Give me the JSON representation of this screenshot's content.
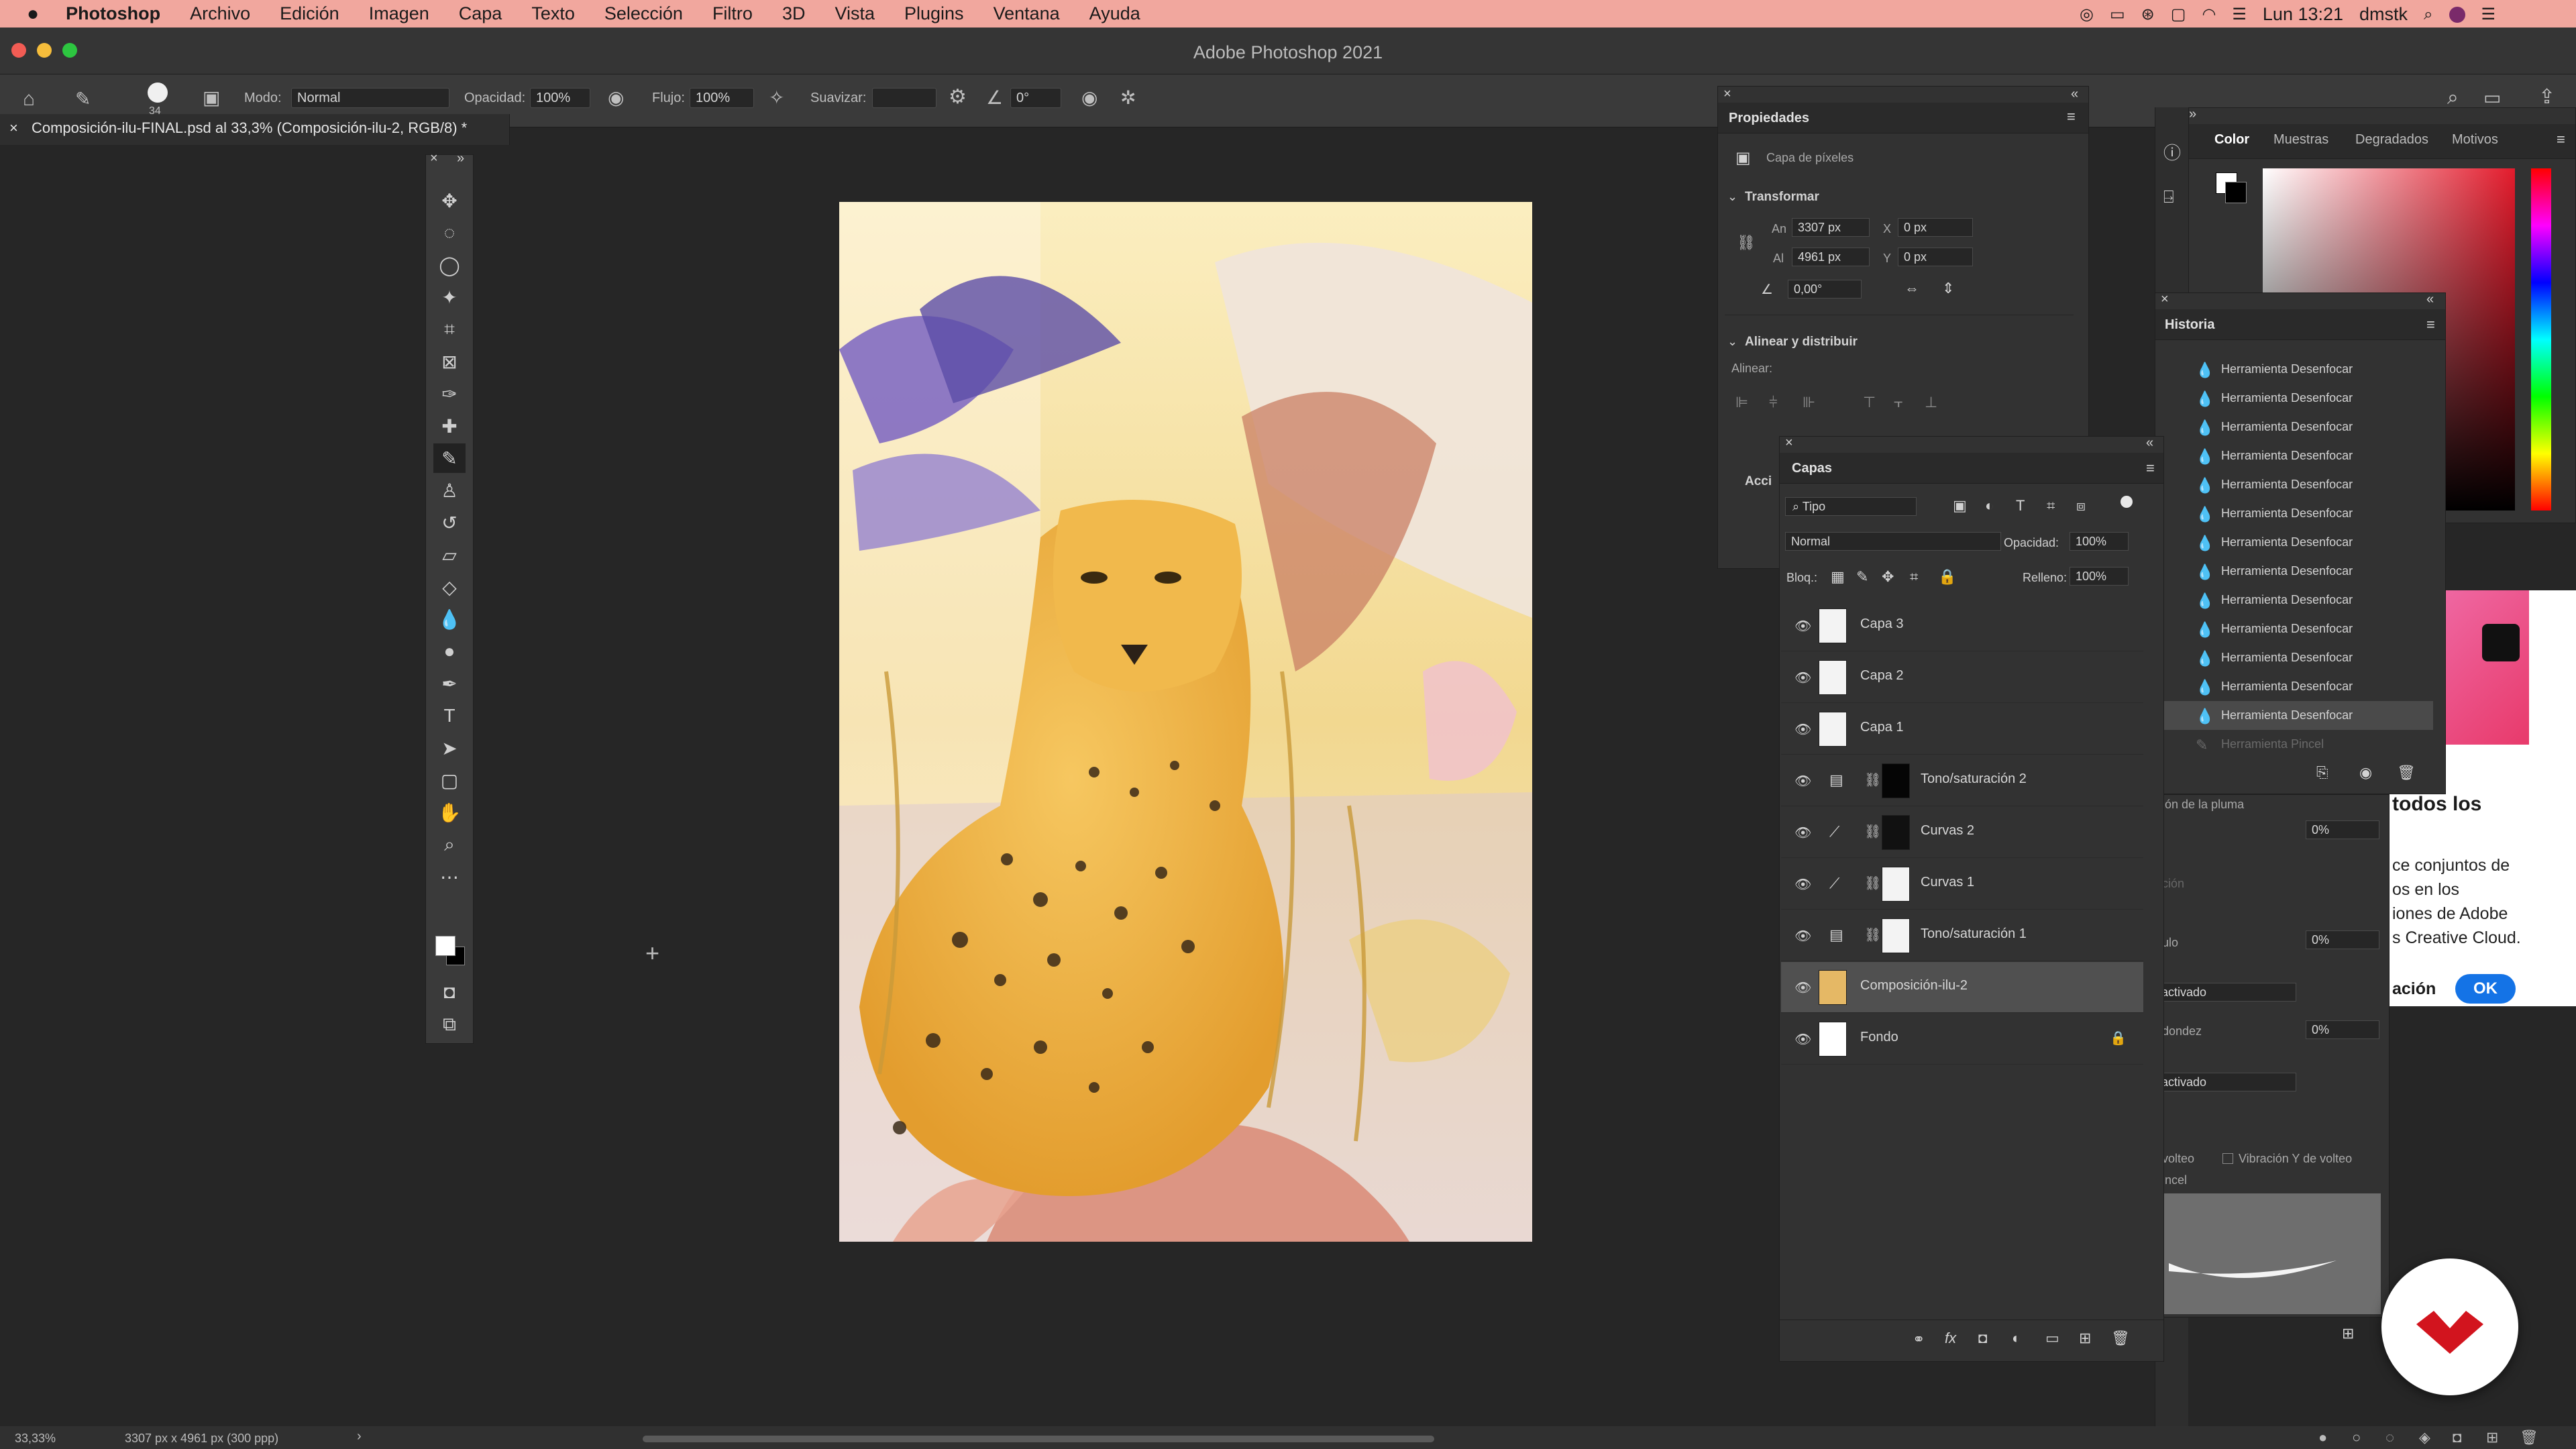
{
  "menubar": {
    "apple": "",
    "app": "Photoshop",
    "items": [
      "Archivo",
      "Edición",
      "Imagen",
      "Capa",
      "Texto",
      "Selección",
      "Filtro",
      "3D",
      "Vista",
      "Plugins",
      "Ventana",
      "Ayuda"
    ],
    "clock": "Lun 13:21",
    "user": "dmstk"
  },
  "window": {
    "title": "Adobe Photoshop 2021"
  },
  "options": {
    "brush_size": "34",
    "mode_label": "Modo:",
    "mode_value": "Normal",
    "opacity_label": "Opacidad:",
    "opacity_value": "100%",
    "flow_label": "Flujo:",
    "flow_value": "100%",
    "smoothing_label": "Suavizar:",
    "angle_value": "0°"
  },
  "document": {
    "tab_title": "Composición-ilu-FINAL.psd al 33,3% (Composición-ilu-2, RGB/8) *"
  },
  "toolbar": {
    "icons": [
      "move-icon",
      "marquee-icon",
      "lasso-icon",
      "magic-wand-icon",
      "crop-icon",
      "frame-icon",
      "eyedropper-icon",
      "healing-icon",
      "brush-icon",
      "stamp-icon",
      "history-brush-icon",
      "eraser-icon",
      "bucket-icon",
      "blur-icon",
      "dodge-icon",
      "pen-icon",
      "type-icon",
      "path-select-icon",
      "shape-icon",
      "hand-icon",
      "zoom-icon",
      "more-icon"
    ]
  },
  "properties": {
    "title": "Propiedades",
    "kind": "Capa de píxeles",
    "transform": "Transformar",
    "w_label": "An",
    "w_value": "3307 px",
    "h_label": "Al",
    "h_value": "4961 px",
    "x_label": "X",
    "x_value": "0 px",
    "y_label": "Y",
    "y_value": "0 px",
    "angle": "0,00°",
    "align_section": "Alinear y distribuir",
    "align_label": "Alinear:",
    "acc": "Acci"
  },
  "color_panel": {
    "tabs": [
      "Color",
      "Muestras",
      "Degradados",
      "Motivos"
    ]
  },
  "history": {
    "title": "Historia",
    "items": [
      "Herramienta Desenfocar",
      "Herramienta Desenfocar",
      "Herramienta Desenfocar",
      "Herramienta Desenfocar",
      "Herramienta Desenfocar",
      "Herramienta Desenfocar",
      "Herramienta Desenfocar",
      "Herramienta Desenfocar",
      "Herramienta Desenfocar",
      "Herramienta Desenfocar",
      "Herramienta Desenfocar",
      "Herramienta Desenfocar",
      "Herramienta Desenfocar",
      "Herramienta Pincel"
    ]
  },
  "layers": {
    "title": "Capas",
    "filter": "Tipo",
    "blend": "Normal",
    "opacity_label": "Opacidad:",
    "opacity_value": "100%",
    "lock_label": "Bloq.:",
    "fill_label": "Relleno:",
    "fill_value": "100%",
    "items": [
      {
        "name": "Capa 3"
      },
      {
        "name": "Capa 2"
      },
      {
        "name": "Capa 1"
      },
      {
        "name": "Tono/saturación 2"
      },
      {
        "name": "Curvas 2"
      },
      {
        "name": "Curvas 1"
      },
      {
        "name": "Tono/saturación 1"
      },
      {
        "name": "Composición-ilu-2"
      },
      {
        "name": "Fondo"
      }
    ]
  },
  "brush_settings": {
    "rows": [
      "ión de la pluma",
      "0%",
      "ción",
      "ulo",
      "0%",
      "activado",
      "dondez",
      "0%",
      "activado"
    ],
    "volteo": "volteo",
    "vib_label": "Vibración Y de volteo",
    "pincel": "incel"
  },
  "cc_popup": {
    "heading": "todos los",
    "body": [
      "ce conjuntos de",
      "os en los",
      "iones de Adobe",
      "s Creative Cloud."
    ],
    "link": "ación",
    "ok": "OK"
  },
  "status": {
    "zoom": "33,33%",
    "doc": "3307 px x 4961 px (300 ppp)"
  }
}
